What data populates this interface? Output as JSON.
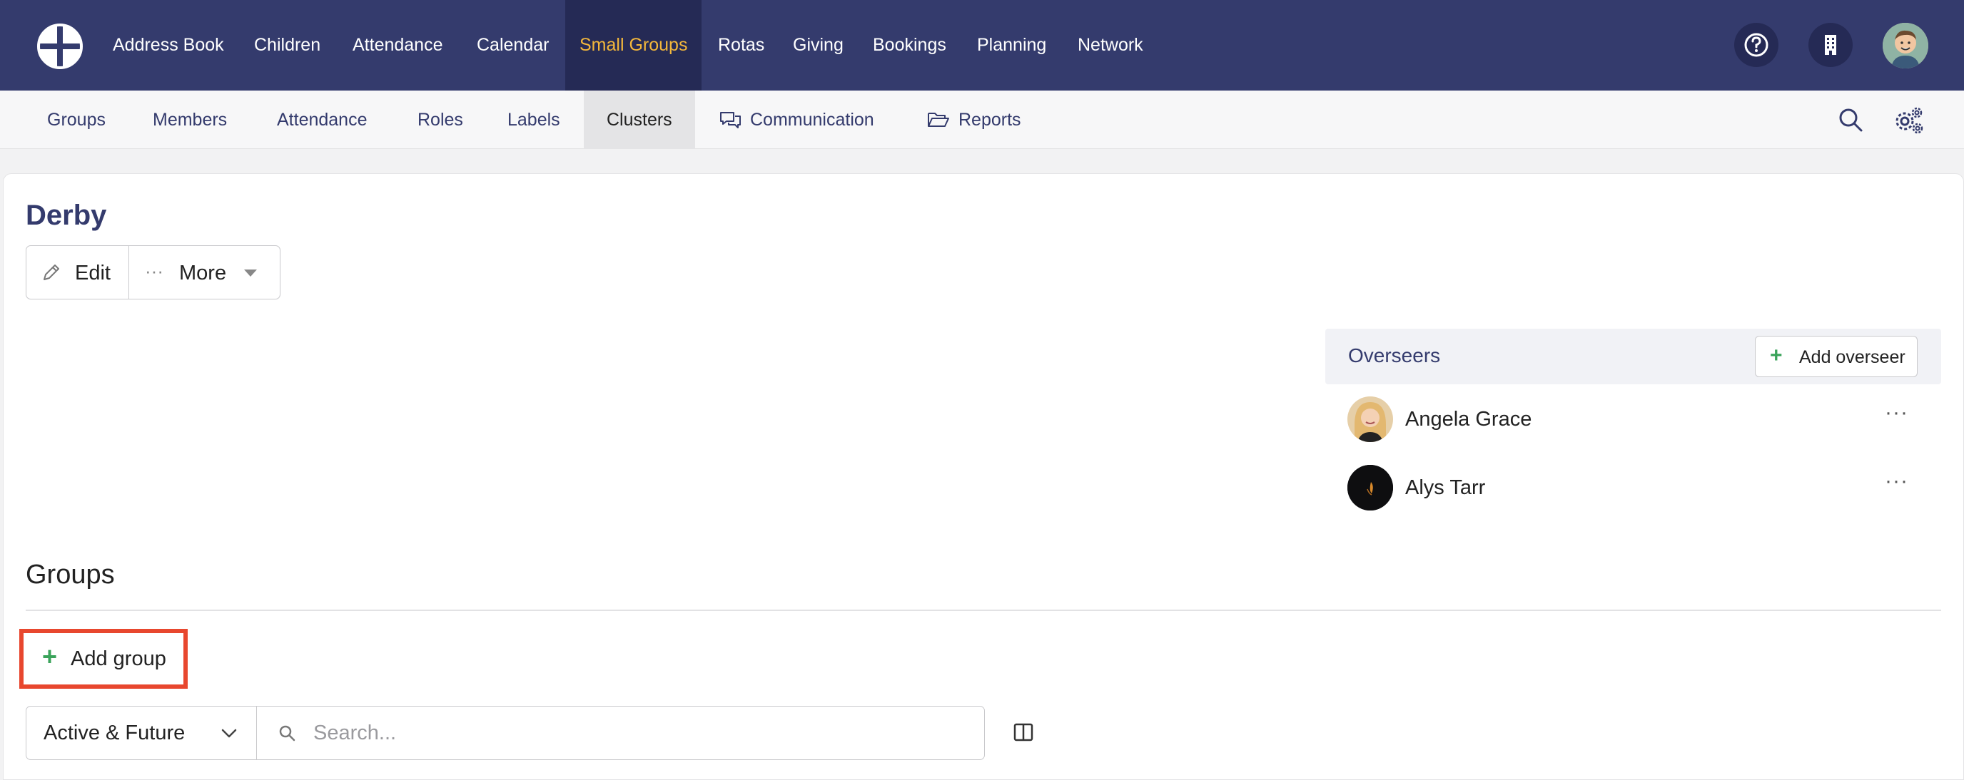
{
  "topnav": {
    "items": [
      {
        "label": "Address Book"
      },
      {
        "label": "Children"
      },
      {
        "label": "Attendance"
      },
      {
        "label": "Calendar"
      },
      {
        "label": "Small Groups"
      },
      {
        "label": "Rotas"
      },
      {
        "label": "Giving"
      },
      {
        "label": "Bookings"
      },
      {
        "label": "Planning"
      },
      {
        "label": "Network"
      }
    ],
    "active": "Small Groups"
  },
  "subnav": {
    "items": [
      {
        "label": "Groups"
      },
      {
        "label": "Members"
      },
      {
        "label": "Attendance"
      },
      {
        "label": "Roles"
      },
      {
        "label": "Labels"
      },
      {
        "label": "Clusters"
      },
      {
        "label": "Communication"
      },
      {
        "label": "Reports"
      }
    ],
    "active": "Clusters"
  },
  "page": {
    "title": "Derby",
    "edit_label": "Edit",
    "more_label": "More"
  },
  "overseers": {
    "title": "Overseers",
    "add_label": "Add overseer",
    "people": [
      {
        "name": "Angela Grace"
      },
      {
        "name": "Alys Tarr"
      }
    ]
  },
  "groups": {
    "title": "Groups",
    "add_label": "Add group",
    "filter_value": "Active & Future",
    "search_placeholder": "Search..."
  },
  "colors": {
    "nav_bg": "#343b6d",
    "nav_active_bg": "#252a55",
    "nav_active_text": "#f3b73b",
    "accent_green": "#3aa35a",
    "highlight_red": "#e8472e"
  }
}
